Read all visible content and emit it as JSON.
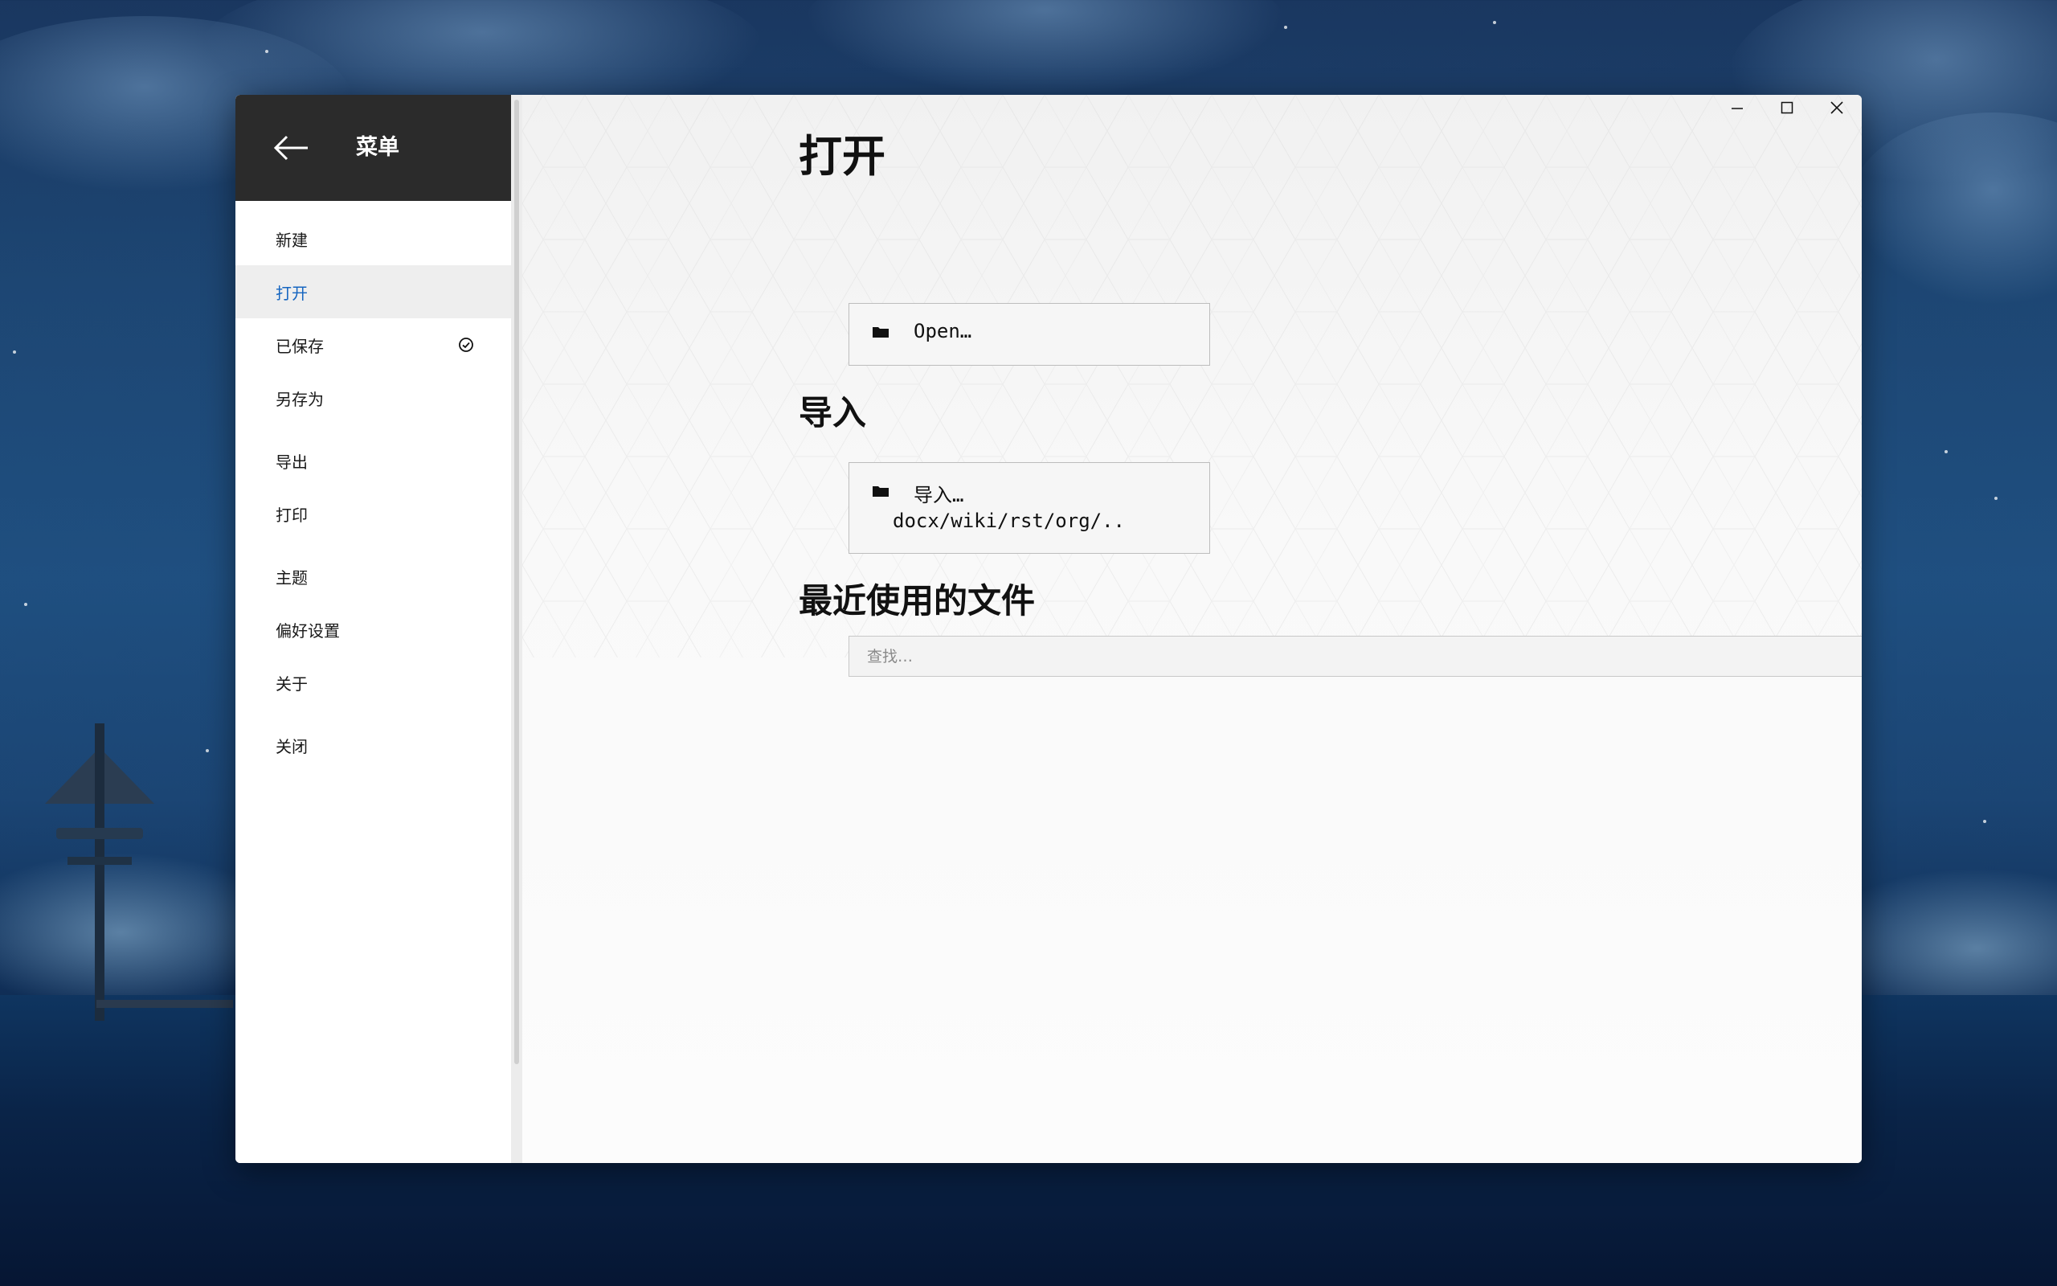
{
  "sidebar": {
    "title": "菜单",
    "back_icon": "arrow-left-icon",
    "items": [
      {
        "label": "新建",
        "active": false
      },
      {
        "label": "打开",
        "active": true
      },
      {
        "label": "已保存",
        "active": false,
        "icon": "check-circle-icon"
      },
      {
        "label": "另存为",
        "active": false
      },
      {
        "label": "导出",
        "active": false
      },
      {
        "label": "打印",
        "active": false
      },
      {
        "label": "主题",
        "active": false
      },
      {
        "label": "偏好设置",
        "active": false
      },
      {
        "label": "关于",
        "active": false
      },
      {
        "label": "关闭",
        "active": false
      }
    ]
  },
  "main": {
    "open_section": {
      "title": "打开",
      "button_label": "Open…",
      "icon": "folder-icon"
    },
    "import_section": {
      "title": "导入",
      "button_label": "导入…",
      "button_sub": "docx/wiki/rst/org/..",
      "icon": "folder-icon"
    },
    "recent_section": {
      "title": "最近使用的文件",
      "search_placeholder": "查找…",
      "more_label": "···"
    }
  },
  "window_controls": [
    "minimize-icon",
    "maximize-icon",
    "close-icon"
  ],
  "colors": {
    "sidebar_header": "#2b2b2b",
    "active_item": "#1565c0",
    "active_bg": "#eeeeee"
  }
}
